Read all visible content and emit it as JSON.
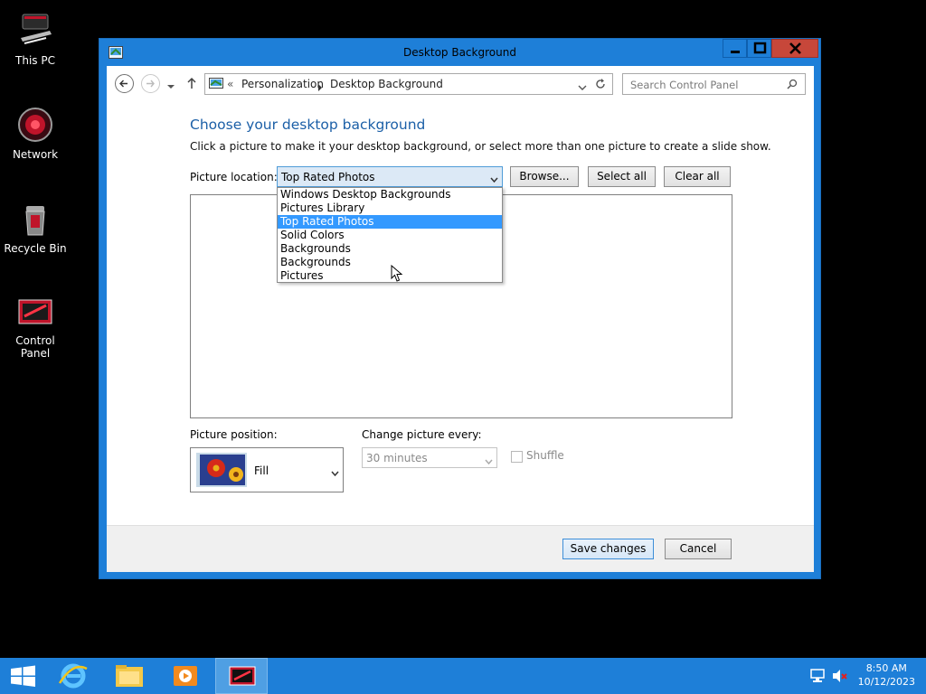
{
  "desktop": {
    "icons": [
      {
        "label": "This PC"
      },
      {
        "label": "Network"
      },
      {
        "label": "Recycle Bin"
      },
      {
        "label": "Control Panel"
      }
    ]
  },
  "window": {
    "title": "Desktop Background",
    "address": {
      "overflow": "«",
      "crumbs": [
        "Personalization",
        "Desktop Background"
      ]
    },
    "search_placeholder": "Search Control Panel"
  },
  "content": {
    "heading": "Choose your desktop background",
    "subtext": "Click a picture to make it your desktop background, or select more than one picture to create a slide show.",
    "picture_location_label": "Picture location:",
    "picture_location_value": "Top Rated Photos",
    "browse_label": "Browse...",
    "select_all_label": "Select all",
    "clear_all_label": "Clear all",
    "location_options": [
      "Windows Desktop Backgrounds",
      "Pictures Library",
      "Top Rated Photos",
      "Solid Colors",
      "Backgrounds",
      "Backgrounds",
      "Pictures"
    ],
    "selected_option_index": 2,
    "picture_position_label": "Picture position:",
    "picture_position_value": "Fill",
    "change_every_label": "Change picture every:",
    "change_every_value": "30 minutes",
    "shuffle_label": "Shuffle"
  },
  "footer": {
    "save_label": "Save changes",
    "cancel_label": "Cancel"
  },
  "taskbar": {
    "time": "8:50 AM",
    "date": "10/12/2023"
  },
  "colors": {
    "window_frame": "#1e7fd8",
    "heading": "#1b5fa7",
    "selection": "#3399ff",
    "close_button": "#c7473a"
  }
}
